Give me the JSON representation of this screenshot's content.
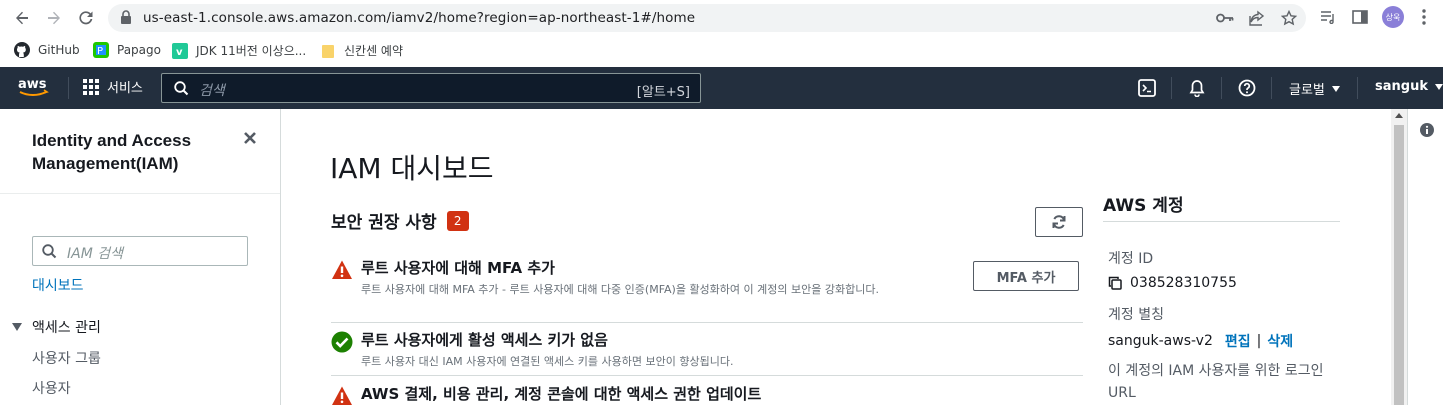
{
  "browser": {
    "url": "us-east-1.console.aws.amazon.com/iamv2/home?region=ap-northeast-1#/home",
    "profile_initials": "상욱",
    "bookmarks": [
      {
        "label": "GitHub"
      },
      {
        "label": "Papago"
      },
      {
        "label": "JDK 11버전 이상으..."
      },
      {
        "label": "신칸센 예약"
      }
    ]
  },
  "topnav": {
    "services_label": "서비스",
    "search_placeholder": "검색",
    "search_shortcut": "[알트+S]",
    "region_label": "글로벌",
    "user_label": "sanguk"
  },
  "sidebar": {
    "title": "Identity and Access Management(IAM)",
    "search_placeholder": "IAM 검색",
    "dashboard_link": "대시보드",
    "section_label": "액세스 관리",
    "items": [
      {
        "label": "사용자 그룹"
      },
      {
        "label": "사용자"
      }
    ]
  },
  "main": {
    "page_title": "IAM 대시보드",
    "security_title": "보안 권장 사항",
    "security_count": "2",
    "recommendations": [
      {
        "status": "warning",
        "title": "루트 사용자에 대해 MFA 추가",
        "description": "루트 사용자에 대해 MFA 추가 - 루트 사용자에 대해 다중 인증(MFA)을 활성화하여 이 계정의 보안을 강화합니다.",
        "action_label": "MFA 추가"
      },
      {
        "status": "ok",
        "title": "루트 사용자에게 활성 액세스 키가 없음",
        "description": "루트 사용자 대신 IAM 사용자에 연결된 액세스 키를 사용하면 보안이 향상됩니다."
      },
      {
        "status": "warning",
        "title": "AWS 결제, 비용 관리, 계정 콘솔에 대한 액세스 권한 업데이트"
      }
    ]
  },
  "account": {
    "title": "AWS 계정",
    "id_label": "계정 ID",
    "id_value": "038528310755",
    "alias_label": "계정 별칭",
    "alias_value": "sanguk-aws-v2",
    "edit_label": "편집",
    "delete_label": "삭제",
    "signin_label": "이 계정의 IAM 사용자를 위한 로그인 URL"
  },
  "colors": {
    "aws_nav_bg": "#232f3e",
    "link": "#0073bb",
    "warning": "#d13212",
    "success": "#1d8102",
    "aws_orange": "#ff9900"
  }
}
